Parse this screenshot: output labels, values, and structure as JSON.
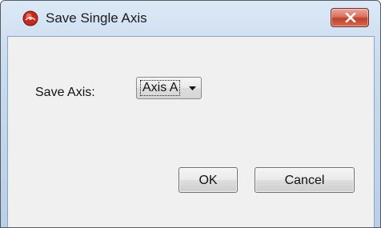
{
  "window": {
    "title": "Save Single Axis",
    "app_icon": "app-logo-icon",
    "close_icon": "close-icon"
  },
  "form": {
    "save_axis_label": "Save Axis:",
    "axis_select": {
      "selected": "Axis A",
      "arrow_icon": "chevron-down-icon"
    }
  },
  "buttons": {
    "ok_label": "OK",
    "cancel_label": "Cancel"
  },
  "colors": {
    "title_bar": "#c9dbef",
    "close_button": "#c2402a",
    "client_background": "#f0f0f0"
  }
}
